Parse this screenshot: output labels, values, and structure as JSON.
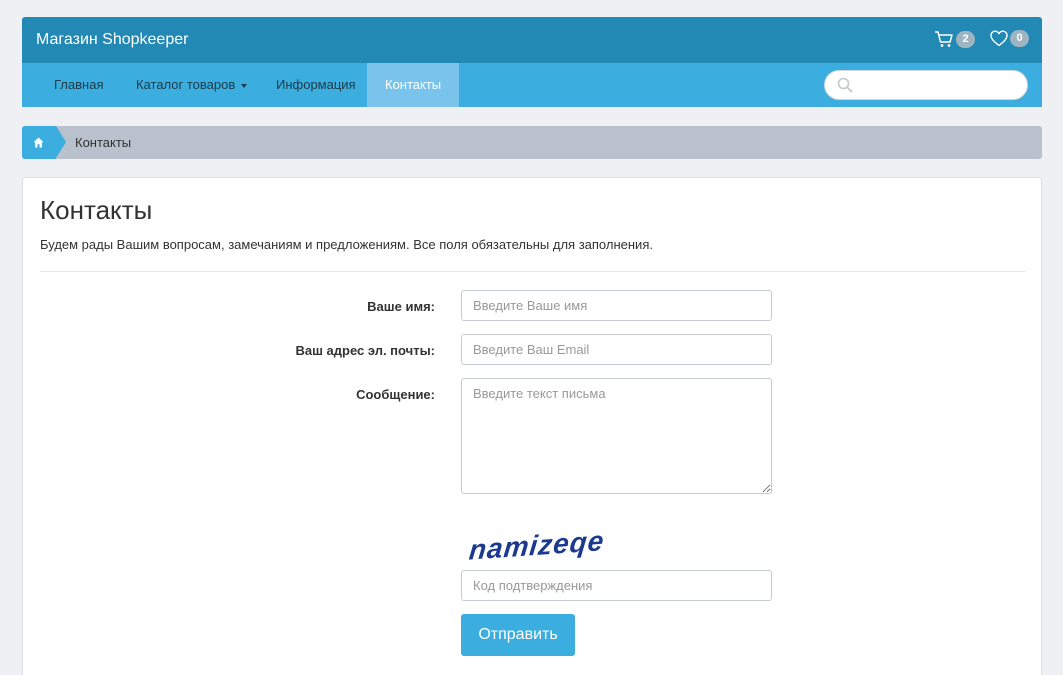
{
  "header": {
    "brand": "Магазин Shopkeeper",
    "cart_count": "2",
    "wishlist_count": "0",
    "cart_icon": "cart-icon",
    "wishlist_icon": "heart-icon"
  },
  "nav": {
    "items": [
      {
        "label": "Главная"
      },
      {
        "label": "Каталог товаров",
        "has_dropdown": true
      },
      {
        "label": "Информация"
      },
      {
        "label": "Контакты",
        "active": true
      }
    ],
    "search": {
      "placeholder": "",
      "value": ""
    }
  },
  "breadcrumb": {
    "home_icon": "home-icon",
    "current": "Контакты"
  },
  "page": {
    "title": "Контакты",
    "intro": "Будем рады Вашим вопросам, замечаниям и предложениям. Все поля обязательны для заполнения."
  },
  "form": {
    "name_label": "Ваше имя:",
    "name_placeholder": "Введите Ваше имя",
    "email_label": "Ваш адрес эл. почты:",
    "email_placeholder": "Введите Ваш Email",
    "message_label": "Сообщение:",
    "message_placeholder": "Введите текст письма",
    "captcha_text": "namizeqe",
    "captcha_placeholder": "Код подтверждения",
    "submit_label": "Отправить"
  },
  "colors": {
    "header_bg": "#2189b3",
    "nav_bg": "#3badde",
    "nav_active": "#79c3ec",
    "breadcrumb_bg": "#b9c1cc",
    "accent": "#3badde"
  }
}
